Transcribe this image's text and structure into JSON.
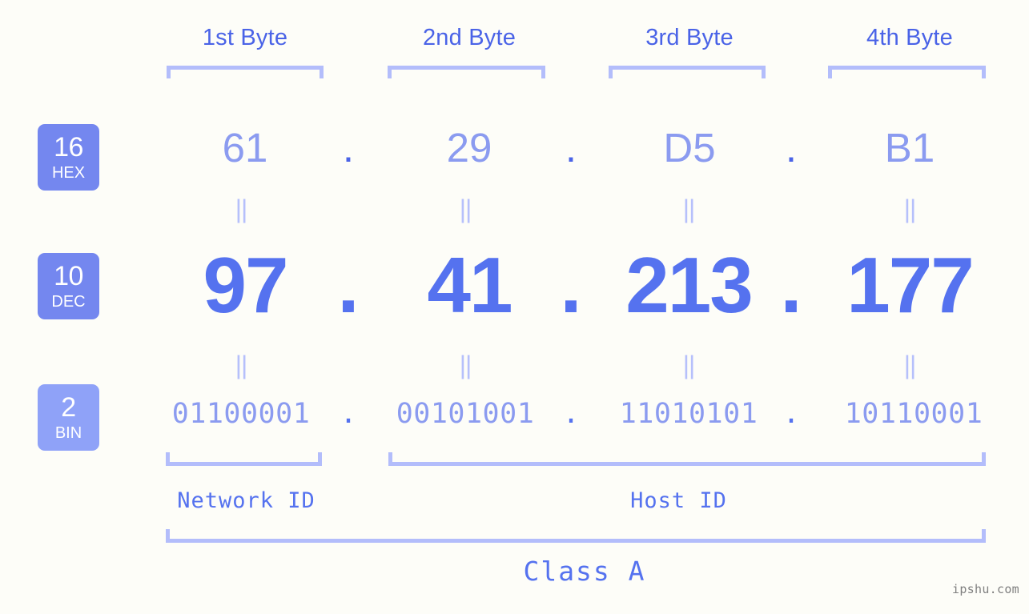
{
  "meta": {
    "background_color": "#fdfdf8",
    "accent_strong": "#4a63e7",
    "accent_mid": "#5572ef",
    "accent_light": "#8b9bf0",
    "accent_pale": "#b3bdfb",
    "badge_fill": "#7487ef",
    "badge_fill_light": "#8fa2f8",
    "watermark": "ipshu.com"
  },
  "byte_headers": [
    {
      "label": "1st Byte"
    },
    {
      "label": "2nd Byte"
    },
    {
      "label": "3rd Byte"
    },
    {
      "label": "4th Byte"
    }
  ],
  "radix_badges": [
    {
      "number": "16",
      "name": "HEX"
    },
    {
      "number": "10",
      "name": "DEC"
    },
    {
      "number": "2",
      "name": "BIN"
    }
  ],
  "rows": {
    "hex": {
      "radix": "16",
      "radix_name": "HEX",
      "values": [
        "61",
        "29",
        "D5",
        "B1"
      ],
      "separator": "."
    },
    "dec": {
      "radix": "10",
      "radix_name": "DEC",
      "values": [
        "97",
        "41",
        "213",
        "177"
      ],
      "separator": ".",
      "full": "97.41.213.177"
    },
    "bin": {
      "radix": "2",
      "radix_name": "BIN",
      "values": [
        "01100001",
        "00101001",
        "11010101",
        "10110001"
      ],
      "separator": ".",
      "full": "01100001.00101001.11010101.10110001"
    }
  },
  "equals_marks": {
    "glyph": "||",
    "count_per_row": 4
  },
  "id_sections": [
    {
      "label": "Network ID",
      "bytes": [
        1
      ]
    },
    {
      "label": "Host ID",
      "bytes": [
        2,
        3,
        4
      ]
    }
  ],
  "class": {
    "label": "Class A"
  }
}
